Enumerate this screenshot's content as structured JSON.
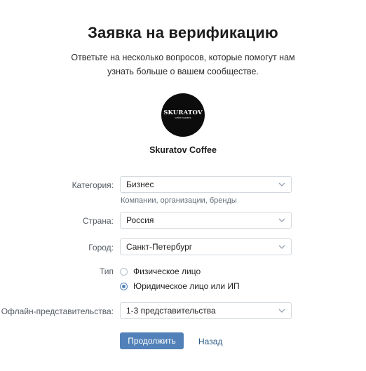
{
  "page": {
    "title": "Заявка на верификацию",
    "subtitle_line1": "Ответьте на несколько вопросов, которые помогут нам",
    "subtitle_line2": "узнать больше о вашем сообществе."
  },
  "community": {
    "logo_text": "SKURATOV",
    "logo_subtext": "coffee roasters",
    "name": "Skuratov Coffee"
  },
  "form": {
    "category": {
      "label": "Категория:",
      "value": "Бизнес",
      "hint": "Компании, организации, бренды"
    },
    "country": {
      "label": "Страна:",
      "value": "Россия"
    },
    "city": {
      "label": "Город:",
      "value": "Санкт-Петербург"
    },
    "type": {
      "label": "Тип",
      "options": [
        {
          "label": "Физическое лицо",
          "checked": false
        },
        {
          "label": "Юридическое лицо или ИП",
          "checked": true
        }
      ]
    },
    "offline": {
      "label": "Офлайн-представительства:",
      "value": "1-3 представительства"
    }
  },
  "actions": {
    "continue_label": "Продолжить",
    "back_label": "Назад"
  },
  "colors": {
    "accent": "#5181b8",
    "link": "#2a5885",
    "border": "#d3d9de"
  },
  "icons": {
    "select_arrow": "chevron-down-icon",
    "radio": "radio-button"
  }
}
